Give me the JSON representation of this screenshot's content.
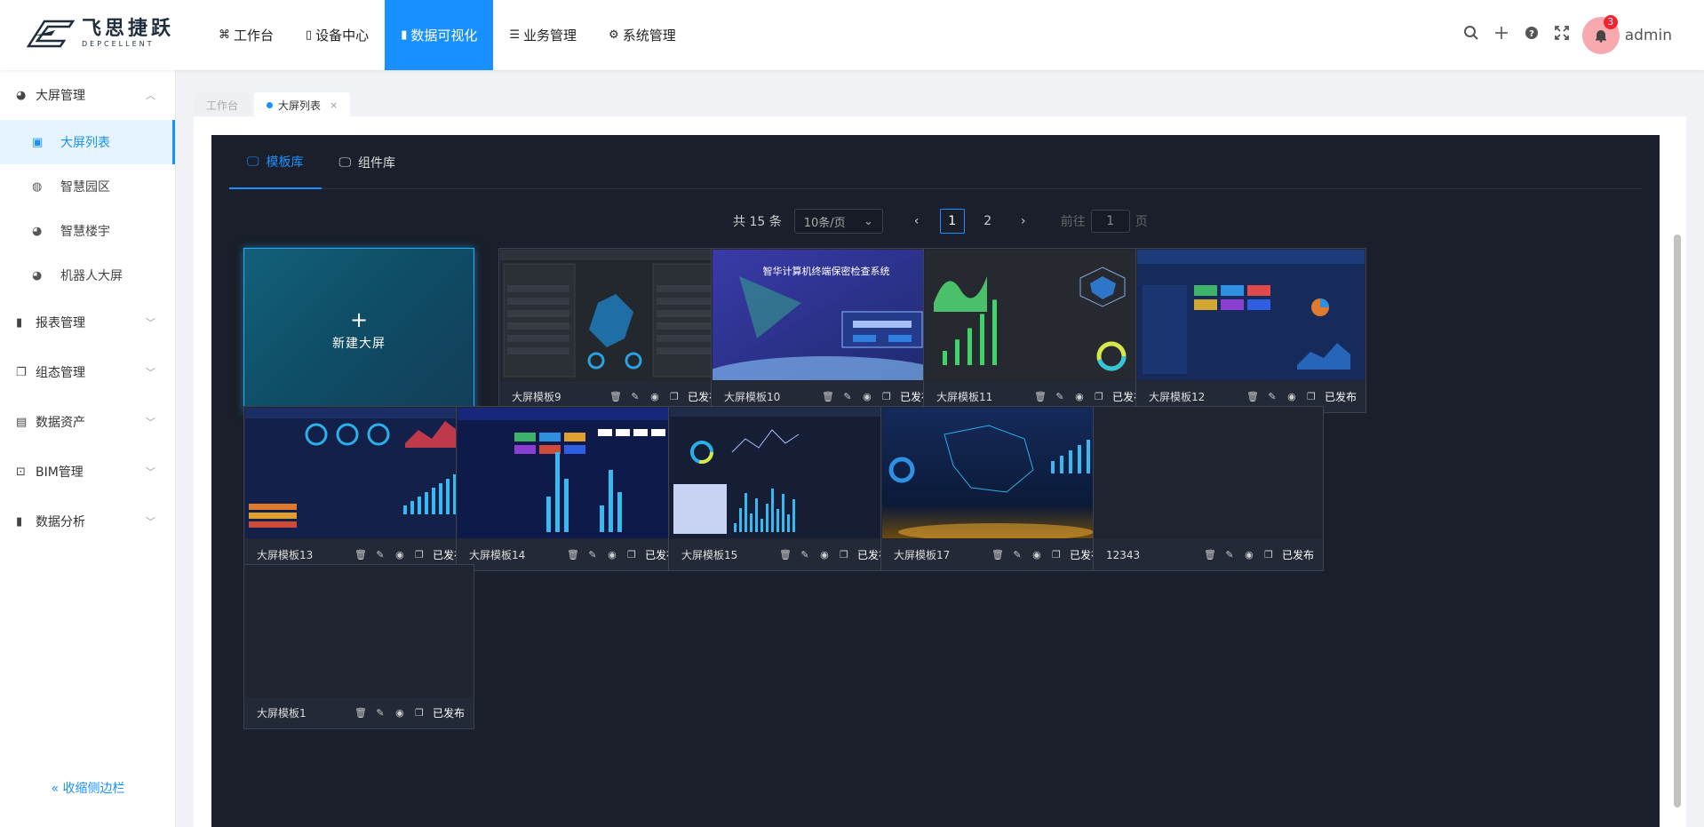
{
  "logo": {
    "cn": "飞思捷跃",
    "en": "DEPCELLENT"
  },
  "topnav": [
    {
      "label": "工作台",
      "icon": "dashboard-icon",
      "glyph": "⌘"
    },
    {
      "label": "设备中心",
      "icon": "mobile-icon",
      "glyph": "▯"
    },
    {
      "label": "数据可视化",
      "icon": "bar-chart-icon",
      "glyph": "▮"
    },
    {
      "label": "业务管理",
      "icon": "list-icon",
      "glyph": "☰"
    },
    {
      "label": "系统管理",
      "icon": "gear-icon",
      "glyph": "⚙"
    }
  ],
  "header": {
    "notification_count": "3",
    "user": "admin"
  },
  "sidebar": {
    "group1": {
      "label": "大屏管理"
    },
    "subs": [
      {
        "label": "大屏列表"
      },
      {
        "label": "智慧园区"
      },
      {
        "label": "智慧楼宇"
      },
      {
        "label": "机器人大屏"
      }
    ],
    "groups": [
      {
        "label": "报表管理"
      },
      {
        "label": "组态管理"
      },
      {
        "label": "数据资产"
      },
      {
        "label": "BIM管理"
      },
      {
        "label": "数据分析"
      }
    ],
    "collapse": "收缩侧边栏"
  },
  "view_tabs": {
    "home": "工作台",
    "current": "大屏列表",
    "close": "×"
  },
  "panel_tabs": {
    "templates": "模板库",
    "components": "组件库"
  },
  "pager": {
    "total": "共 15 条",
    "page_size": "10条/页",
    "pages": [
      "1",
      "2"
    ],
    "goto_prefix": "前往",
    "goto_value": "1",
    "goto_suffix": "页"
  },
  "new_screen": {
    "label": "新建大屏",
    "plus": "+"
  },
  "cards": [
    {
      "name": "大屏模板9",
      "status": "已发布",
      "thumb": "t9"
    },
    {
      "name": "大屏模板10",
      "status": "已发布",
      "thumb": "t10"
    },
    {
      "name": "大屏模板11",
      "status": "已发布",
      "thumb": "t11"
    },
    {
      "name": "大屏模板12",
      "status": "已发布",
      "thumb": "t12"
    },
    {
      "name": "大屏模板13",
      "status": "已发布",
      "thumb": "t13"
    },
    {
      "name": "大屏模板14",
      "status": "已发布",
      "thumb": "t14"
    },
    {
      "name": "大屏模板15",
      "status": "已发布",
      "thumb": "t15"
    },
    {
      "name": "大屏模板17",
      "status": "已发布",
      "thumb": "t17"
    },
    {
      "name": "12343",
      "status": "已发布",
      "thumb": "empty"
    },
    {
      "name": "大屏模板1",
      "status": "已发布",
      "thumb": "empty"
    }
  ],
  "thumb_texts": {
    "t10": "智华计算机终端保密检查系统"
  }
}
